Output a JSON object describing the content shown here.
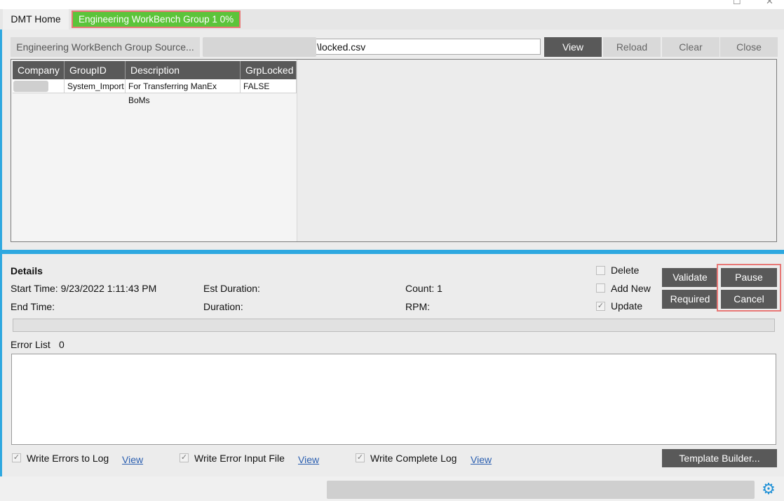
{
  "window": {
    "maximize_glyph": "☐",
    "close_glyph": "✕"
  },
  "tabs": [
    {
      "label": "DMT Home"
    },
    {
      "label": "Engineering WorkBench Group 1 0%"
    }
  ],
  "toolbar": {
    "source_button": "Engineering WorkBench Group Source...",
    "path_value": "\\locked.csv",
    "view": "View",
    "reload": "Reload",
    "clear": "Clear",
    "close": "Close"
  },
  "grid": {
    "columns": [
      "Company",
      "GroupID",
      "Description",
      "GrpLocked"
    ],
    "rows": [
      {
        "company": "",
        "group_id": "System_Import",
        "description": "For Transferring ManEx BoMs",
        "grp_locked": "FALSE"
      }
    ]
  },
  "details": {
    "heading": "Details",
    "start_time": "Start Time: 9/23/2022 1:11:43 PM",
    "end_time": "End Time:",
    "est_duration": "Est Duration:",
    "duration": "Duration:",
    "count": "Count: 1",
    "rpm": "RPM:"
  },
  "options": {
    "delete": {
      "label": "Delete",
      "checked": false
    },
    "add_new": {
      "label": "Add New",
      "checked": false
    },
    "update": {
      "label": "Update",
      "checked": true
    }
  },
  "actions": {
    "validate": "Validate",
    "required": "Required",
    "pause": "Pause",
    "cancel": "Cancel"
  },
  "errors": {
    "label": "Error List",
    "count": "0"
  },
  "logging": {
    "write_errors": "Write Errors to Log",
    "write_error_input": "Write Error Input File",
    "write_complete": "Write Complete Log",
    "view_link": "View",
    "check_glyph": "✓"
  },
  "template_builder": "Template Builder...",
  "colors": {
    "accent_blue": "#2ea8e0",
    "tab_green": "#5cc43a",
    "highlight_red": "#e87876",
    "button_dark": "#595959"
  }
}
